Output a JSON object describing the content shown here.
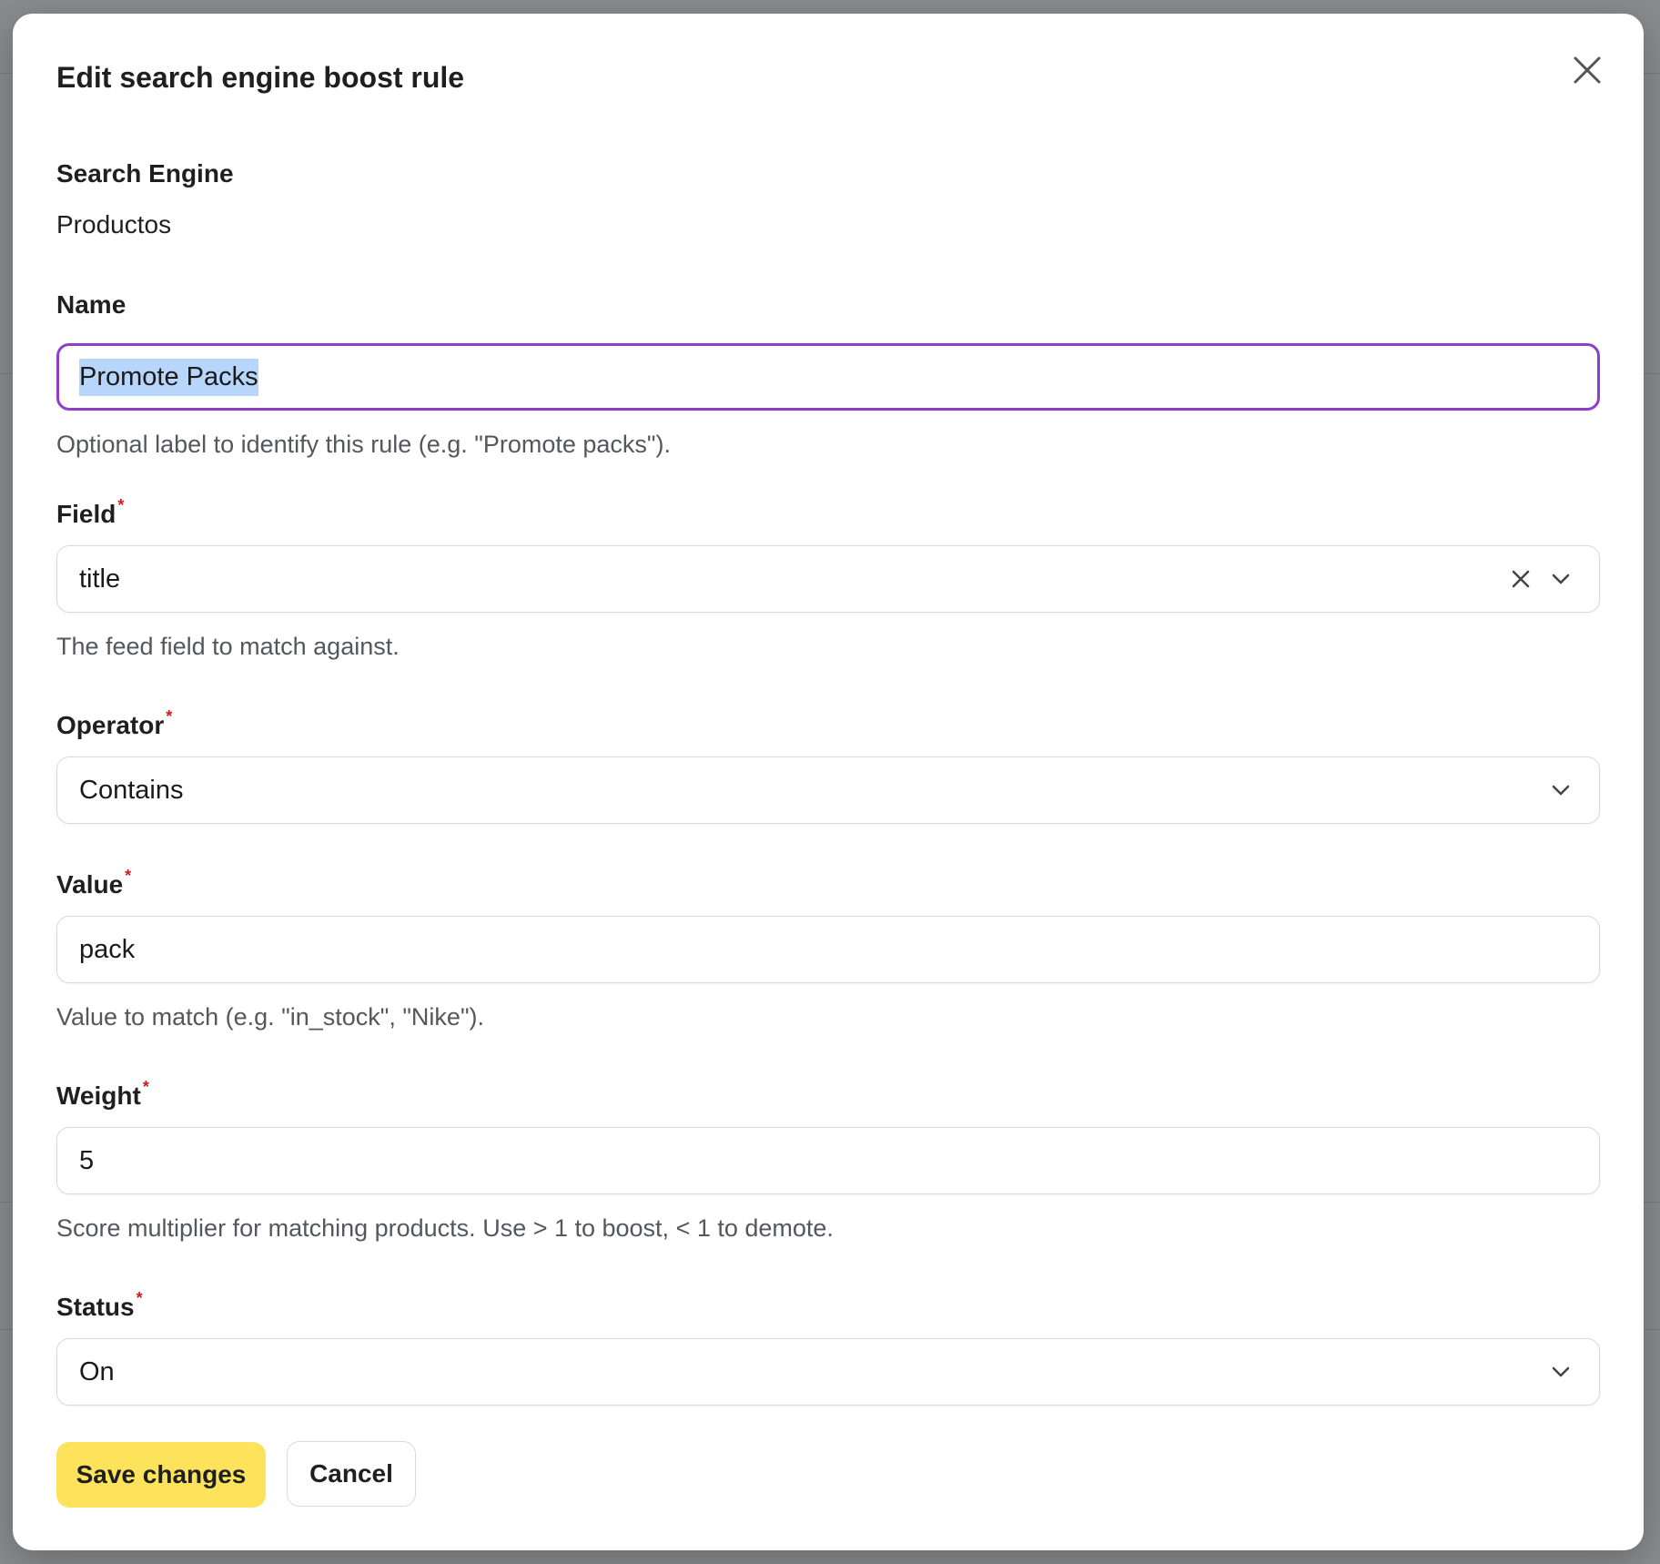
{
  "modal": {
    "title": "Edit search engine boost rule"
  },
  "search_engine": {
    "label": "Search Engine",
    "value": "Productos"
  },
  "name": {
    "label": "Name",
    "value": "Promote Packs",
    "help": "Optional label to identify this rule (e.g. \"Promote packs\")."
  },
  "field": {
    "label": "Field",
    "required_mark": "*",
    "value": "title",
    "help": "The feed field to match against."
  },
  "operator": {
    "label": "Operator",
    "required_mark": "*",
    "value": "Contains"
  },
  "value_field": {
    "label": "Value",
    "required_mark": "*",
    "value": "pack",
    "help": "Value to match (e.g. \"in_stock\", \"Nike\")."
  },
  "weight": {
    "label": "Weight",
    "required_mark": "*",
    "value": "5",
    "help": "Score multiplier for matching products. Use > 1 to boost, < 1 to demote."
  },
  "status": {
    "label": "Status",
    "required_mark": "*",
    "value": "On"
  },
  "actions": {
    "save_label": "Save changes",
    "cancel_label": "Cancel"
  },
  "colors": {
    "focus_border": "#8e3ec9",
    "primary_button": "#fce35b",
    "required": "#d11a1a"
  }
}
